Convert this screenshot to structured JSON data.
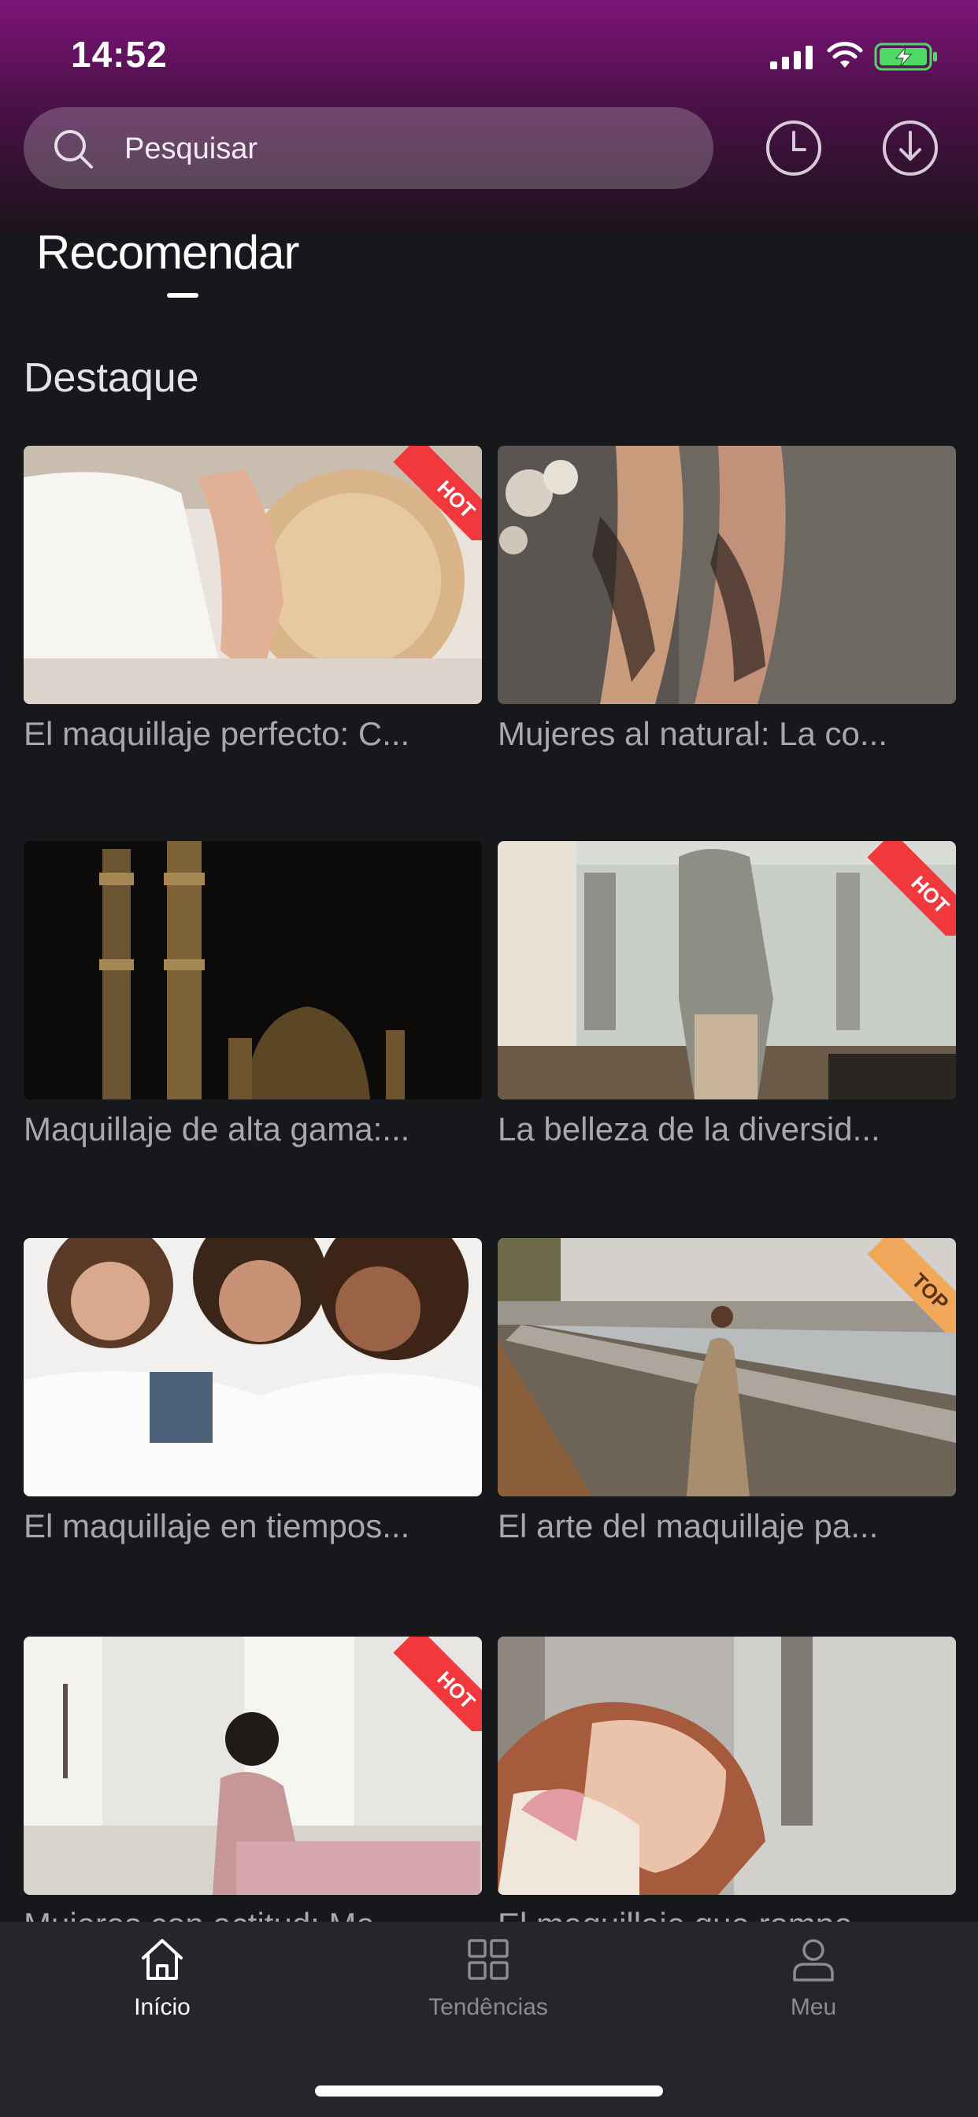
{
  "status_bar": {
    "time": "14:52"
  },
  "search": {
    "placeholder": "Pesquisar"
  },
  "tabs": [
    {
      "label": "Recomendar",
      "active": true
    }
  ],
  "section": {
    "title": "Destaque"
  },
  "cards": [
    {
      "title": "El maquillaje perfecto: C...",
      "badge": "HOT"
    },
    {
      "title": "Mujeres al natural: La co...",
      "badge": ""
    },
    {
      "title": "Maquillaje de alta gama:...",
      "badge": ""
    },
    {
      "title": "La belleza de la diversid...",
      "badge": "HOT"
    },
    {
      "title": "El maquillaje en tiempos...",
      "badge": ""
    },
    {
      "title": "El arte del maquillaje pa...",
      "badge": "TOP"
    },
    {
      "title": "Mujeres con actitud: Ma...",
      "badge": "HOT"
    },
    {
      "title": "El maquillaje que rompe...",
      "badge": ""
    }
  ],
  "bottom_nav": [
    {
      "label": "Início",
      "icon": "home-icon",
      "active": true
    },
    {
      "label": "Tendências",
      "icon": "grid-icon",
      "active": false
    },
    {
      "label": "Meu",
      "icon": "user-icon",
      "active": false
    }
  ],
  "colors": {
    "accent": "#7d1478",
    "hot": "#f0383d",
    "top": "#f2a85a",
    "background": "#17181c",
    "tabbar": "#25262b"
  }
}
